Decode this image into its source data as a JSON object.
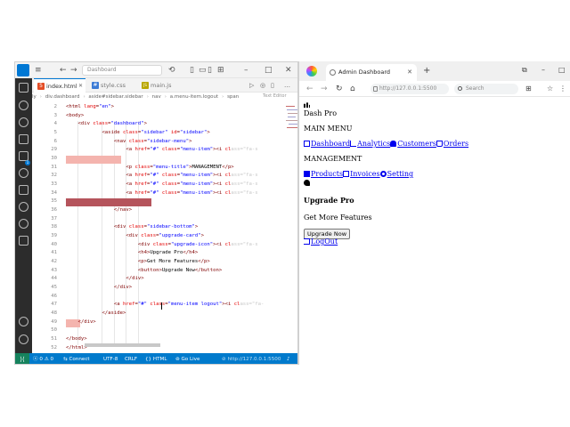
{
  "vscode": {
    "search": "Dashboard",
    "tabs": [
      {
        "label": "index.html",
        "icon": "5",
        "color": "#e44d26",
        "active": true
      },
      {
        "label": "style.css",
        "icon": "#",
        "color": "#3b7bd6",
        "active": false
      },
      {
        "label": "main.js",
        "icon": "JS",
        "color": "#b9a600",
        "active": false
      }
    ],
    "breadcrumb": [
      "ly",
      "div.dashboard",
      "aside#sidebar.sidebar",
      "nav",
      "a.menu-item.logout",
      "span"
    ],
    "text_editor_label": "Text Editor",
    "lines": [
      {
        "n": "2",
        "indent": 0,
        "html": "<span>&lt;html </span><span class=\"at\">lang</span><span>=</span><span class=\"av\">\"en\"</span><span>&gt;</span>"
      },
      {
        "n": "3",
        "indent": 0,
        "html": "<span>&lt;body&gt;</span>"
      },
      {
        "n": "4",
        "indent": 4,
        "html": "<span>&lt;div </span><span class=\"at\">class</span><span>=</span><span class=\"av\">\"dashboard\"</span><span>&gt;</span>"
      },
      {
        "n": "5",
        "indent": 12,
        "html": "<span>&lt;aside </span><span class=\"at\">class</span><span>=</span><span class=\"av\">\"sidebar\"</span><span> </span><span class=\"at\">id</span><span>=</span><span class=\"av\">\"sidebar\"</span><span>&gt;</span>"
      },
      {
        "n": "6",
        "indent": 16,
        "html": "<span>&lt;nav </span><span class=\"at\">class</span><span>=</span><span class=\"av\">\"sidebar-menu\"</span><span>&gt;</span>"
      },
      {
        "n": "29",
        "indent": 20,
        "html": "<span>&lt;a </span><span class=\"at\">href</span><span>=</span><span class=\"av\">\"#\"</span><span> </span><span class=\"at\">class</span><span>=</span><span class=\"av\">\"menu-item\"</span><span>&gt;&lt;i </span><span class=\"at\">cl</span><span class=\"fade\">ass=\"fa-s</span>"
      },
      {
        "n": "30",
        "indent": 0,
        "html": ""
      },
      {
        "n": "31",
        "indent": 20,
        "html": "<span>&lt;p </span><span class=\"at\">class</span><span>=</span><span class=\"av\">\"menu-title\"</span><span>&gt;</span><span class=\"tx\">MANAGEMENT</span><span>&lt;/p&gt;</span>"
      },
      {
        "n": "32",
        "indent": 20,
        "html": "<span>&lt;a </span><span class=\"at\">href</span><span>=</span><span class=\"av\">\"#\"</span><span> </span><span class=\"at\">class</span><span>=</span><span class=\"av\">\"menu-item\"</span><span>&gt;&lt;i </span><span class=\"at\">cl</span><span class=\"fade\">ass=\"fa-s</span>"
      },
      {
        "n": "33",
        "indent": 20,
        "html": "<span>&lt;a </span><span class=\"at\">href</span><span>=</span><span class=\"av\">\"#\"</span><span> </span><span class=\"at\">class</span><span>=</span><span class=\"av\">\"menu-item\"</span><span>&gt;&lt;i </span><span class=\"at\">cl</span><span class=\"fade\">ass=\"fa-s</span>"
      },
      {
        "n": "34",
        "indent": 20,
        "html": "<span>&lt;a </span><span class=\"at\">href</span><span>=</span><span class=\"av\">\"#\"</span><span> </span><span class=\"at\">class</span><span>=</span><span class=\"av\">\"menu-item\"</span><span>&gt;&lt;i </span><span class=\"at\">cl</span><span class=\"fade\">ass=\"fa-s</span>"
      },
      {
        "n": "35",
        "indent": 0,
        "html": ""
      },
      {
        "n": "36",
        "indent": 16,
        "html": "<span>&lt;/nav&gt;</span>"
      },
      {
        "n": "37",
        "indent": 0,
        "html": ""
      },
      {
        "n": "38",
        "indent": 16,
        "html": "<span>&lt;div </span><span class=\"at\">class</span><span>=</span><span class=\"av\">\"sidebar-bottom\"</span><span>&gt;</span>"
      },
      {
        "n": "39",
        "indent": 20,
        "html": "<span>&lt;div </span><span class=\"at\">class</span><span>=</span><span class=\"av\">\"upgrade-card\"</span><span>&gt;</span>"
      },
      {
        "n": "40",
        "indent": 24,
        "html": "<span>&lt;div </span><span class=\"at\">class</span><span>=</span><span class=\"av\">\"upgrade-icon\"</span><span>&gt;&lt;i </span><span class=\"at\">cl</span><span class=\"fade\">ass=\"fa-s</span>"
      },
      {
        "n": "41",
        "indent": 24,
        "html": "<span>&lt;h4&gt;</span><span class=\"tx\">Upgrade Pro</span><span>&lt;/h4&gt;</span>"
      },
      {
        "n": "42",
        "indent": 24,
        "html": "<span>&lt;p&gt;</span><span class=\"tx\">Get More Features</span><span>&lt;/p&gt;</span>"
      },
      {
        "n": "43",
        "indent": 24,
        "html": "<span>&lt;button&gt;</span><span class=\"tx\">Upgrade Now</span><span>&lt;/button&gt;</span>"
      },
      {
        "n": "44",
        "indent": 20,
        "html": "<span>&lt;/div&gt;</span>"
      },
      {
        "n": "45",
        "indent": 16,
        "html": "<span>&lt;/div&gt;</span>"
      },
      {
        "n": "46",
        "indent": 0,
        "html": ""
      },
      {
        "n": "47",
        "indent": 16,
        "html": "<span>&lt;a </span><span class=\"at\">href</span><span>=</span><span class=\"av\">\"#\"</span><span> </span><span class=\"at\">class</span><span>=</span><span class=\"av\">\"menu-item logout\"</span><span>&gt;&lt;i </span><span class=\"at\">cl</span><span class=\"fade\">ass=\"fa-</span>"
      },
      {
        "n": "48",
        "indent": 12,
        "html": "<span>&lt;/aside&gt;</span>"
      },
      {
        "n": "49",
        "indent": 4,
        "html": "<span>&lt;/div&gt;</span>"
      },
      {
        "n": "50",
        "indent": 0,
        "html": ""
      },
      {
        "n": "51",
        "indent": 0,
        "html": "<span>&lt;/body&gt;</span>"
      },
      {
        "n": "52",
        "indent": 0,
        "html": "<span>&lt;/html&gt;</span>"
      }
    ],
    "status": {
      "problems": "ⓧ 0 ⚠ 0",
      "connect": "Connect",
      "encoding": "UTF-8",
      "eol": "CRLF",
      "language": "HTML",
      "golive": "Go Live",
      "url": "http://127.0.0.1:5500"
    },
    "colors": {
      "statusbar": "#007acc",
      "activity": "#2c2c2c",
      "error_light": "#f4b4ae",
      "error_dark": "#b5545c"
    }
  },
  "browser": {
    "tab_title": "Admin Dashboard",
    "url": "http://127.0.0.1:5500",
    "search_placeholder": "Search",
    "page": {
      "brand": "Dash Pro",
      "main_menu_title": "MAIN MENU",
      "main_links": [
        {
          "label": "Dashboard",
          "icon": "home-icon"
        },
        {
          "label": "Analytics",
          "icon": "line-chart-icon"
        },
        {
          "label": "Customers",
          "icon": "users-icon"
        },
        {
          "label": "Orders",
          "icon": "cart-icon"
        }
      ],
      "management_title": "MANAGEMENT",
      "management_links": [
        {
          "label": "Products",
          "icon": "box-icon"
        },
        {
          "label": "Invoices",
          "icon": "invoice-icon"
        },
        {
          "label": "Setting",
          "icon": "gear-icon"
        }
      ],
      "upgrade_title": "Upgrade Pro",
      "upgrade_text": "Get More Features",
      "upgrade_button": "Upgrade Now",
      "logout": "LogOut"
    }
  }
}
